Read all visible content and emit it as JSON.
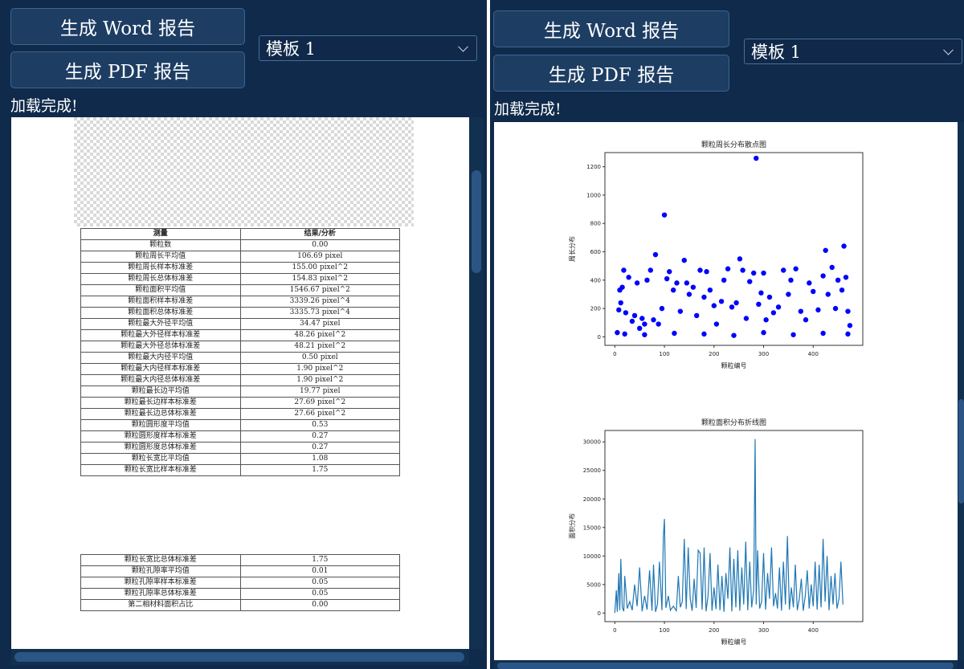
{
  "left": {
    "word_button": "生成 Word 报告",
    "pdf_button": "生成 PDF 报告",
    "template_select": "模板 1",
    "status": "加载完成!",
    "table": {
      "headers": [
        "测量",
        "结果/分析"
      ],
      "rows": [
        [
          "颗粒数",
          "0.00"
        ],
        [
          "颗粒周长平均值",
          "106.69 pixel"
        ],
        [
          "颗粒周长样本标准差",
          "155.00 pixel^2"
        ],
        [
          "颗粒周长总体标准差",
          "154.83 pixel^2"
        ],
        [
          "颗粒面积平均值",
          "1546.67 pixel^2"
        ],
        [
          "颗粒面积样本标准差",
          "3339.26 pixel^4"
        ],
        [
          "颗粒面积总体标准差",
          "3335.73 pixel^4"
        ],
        [
          "颗粒最大外径平均值",
          "34.47 pixel"
        ],
        [
          "颗粒最大外径样本标准差",
          "48.26 pixel^2"
        ],
        [
          "颗粒最大外径总体标准差",
          "48.21 pixel^2"
        ],
        [
          "颗粒最大内径平均值",
          "0.50 pixel"
        ],
        [
          "颗粒最大内径样本标准差",
          "1.90 pixel^2"
        ],
        [
          "颗粒最大内径总体标准差",
          "1.90 pixel^2"
        ],
        [
          "颗粒最长边平均值",
          "19.77 pixel"
        ],
        [
          "颗粒最长边样本标准差",
          "27.69 pixel^2"
        ],
        [
          "颗粒最长边总体标准差",
          "27.66 pixel^2"
        ],
        [
          "颗粒圆形度平均值",
          "0.53"
        ],
        [
          "颗粒圆形度样本标准差",
          "0.27"
        ],
        [
          "颗粒圆形度总体标准差",
          "0.27"
        ],
        [
          "颗粒长宽比平均值",
          "1.08"
        ],
        [
          "颗粒长宽比样本标准差",
          "1.75"
        ]
      ],
      "rows_page2": [
        [
          "颗粒长宽比总体标准差",
          "1.75"
        ],
        [
          "颗粒孔隙率平均值",
          "0.01"
        ],
        [
          "颗粒孔隙率样本标准差",
          "0.05"
        ],
        [
          "颗粒孔隙率总体标准差",
          "0.05"
        ],
        [
          "第二相材料面积占比",
          "0.00"
        ]
      ]
    }
  },
  "right": {
    "word_button": "生成 Word 报告",
    "pdf_button": "生成 PDF 报告",
    "template_select": "模板 1",
    "status": "加载完成!"
  },
  "chart_data": [
    {
      "type": "scatter",
      "title": "颗粒周长分布散点图",
      "xlabel": "颗粒编号",
      "ylabel": "周长分布",
      "xlim": [
        -20,
        500
      ],
      "ylim": [
        -60,
        1300
      ],
      "xticks": [
        "0",
        "100",
        "200",
        "300",
        "400"
      ],
      "yticks": [
        "0",
        "200",
        "400",
        "600",
        "800",
        "1000",
        "1200"
      ],
      "color": "#0000ff",
      "points": [
        [
          5,
          30
        ],
        [
          8,
          190
        ],
        [
          10,
          330
        ],
        [
          12,
          240
        ],
        [
          15,
          350
        ],
        [
          18,
          470
        ],
        [
          22,
          170
        ],
        [
          28,
          420
        ],
        [
          35,
          110
        ],
        [
          40,
          150
        ],
        [
          45,
          380
        ],
        [
          50,
          60
        ],
        [
          55,
          130
        ],
        [
          60,
          90
        ],
        [
          65,
          400
        ],
        [
          72,
          470
        ],
        [
          78,
          120
        ],
        [
          82,
          580
        ],
        [
          88,
          90
        ],
        [
          95,
          200
        ],
        [
          100,
          860
        ],
        [
          105,
          410
        ],
        [
          110,
          460
        ],
        [
          118,
          330
        ],
        [
          125,
          380
        ],
        [
          132,
          180
        ],
        [
          140,
          540
        ],
        [
          145,
          380
        ],
        [
          150,
          300
        ],
        [
          158,
          350
        ],
        [
          165,
          150
        ],
        [
          172,
          470
        ],
        [
          180,
          280
        ],
        [
          185,
          460
        ],
        [
          192,
          330
        ],
        [
          200,
          220
        ],
        [
          205,
          90
        ],
        [
          215,
          250
        ],
        [
          220,
          400
        ],
        [
          228,
          480
        ],
        [
          236,
          210
        ],
        [
          245,
          240
        ],
        [
          252,
          550
        ],
        [
          258,
          470
        ],
        [
          265,
          130
        ],
        [
          272,
          390
        ],
        [
          280,
          450
        ],
        [
          285,
          1260
        ],
        [
          290,
          230
        ],
        [
          295,
          310
        ],
        [
          300,
          450
        ],
        [
          305,
          120
        ],
        [
          312,
          280
        ],
        [
          320,
          170
        ],
        [
          330,
          210
        ],
        [
          340,
          470
        ],
        [
          350,
          300
        ],
        [
          355,
          400
        ],
        [
          365,
          480
        ],
        [
          375,
          180
        ],
        [
          385,
          120
        ],
        [
          392,
          380
        ],
        [
          400,
          320
        ],
        [
          410,
          190
        ],
        [
          420,
          430
        ],
        [
          425,
          610
        ],
        [
          430,
          300
        ],
        [
          438,
          490
        ],
        [
          445,
          200
        ],
        [
          450,
          400
        ],
        [
          458,
          330
        ],
        [
          462,
          640
        ],
        [
          466,
          420
        ],
        [
          470,
          180
        ],
        [
          474,
          80
        ],
        [
          20,
          20
        ],
        [
          60,
          15
        ],
        [
          120,
          25
        ],
        [
          180,
          20
        ],
        [
          240,
          10
        ],
        [
          300,
          30
        ],
        [
          360,
          15
        ],
        [
          420,
          25
        ],
        [
          470,
          20
        ]
      ]
    },
    {
      "type": "line",
      "title": "颗粒面积分布折线图",
      "xlabel": "颗粒编号",
      "ylabel": "面积分布",
      "xlim": [
        -20,
        500
      ],
      "ylim": [
        -1500,
        32000
      ],
      "xticks": [
        "0",
        "100",
        "200",
        "300",
        "400"
      ],
      "yticks": [
        "0",
        "5000",
        "10000",
        "15000",
        "20000",
        "25000",
        "30000"
      ],
      "color": "#1f77b4",
      "x": [
        0,
        3,
        5,
        8,
        10,
        12,
        15,
        18,
        20,
        25,
        30,
        35,
        40,
        45,
        50,
        55,
        60,
        65,
        70,
        75,
        78,
        82,
        86,
        90,
        95,
        98,
        100,
        103,
        108,
        112,
        118,
        124,
        128,
        132,
        136,
        140,
        144,
        148,
        152,
        156,
        160,
        164,
        168,
        172,
        176,
        180,
        184,
        188,
        192,
        196,
        200,
        204,
        208,
        212,
        216,
        220,
        224,
        228,
        232,
        236,
        240,
        244,
        248,
        252,
        256,
        260,
        264,
        268,
        272,
        276,
        280,
        283,
        285,
        288,
        292,
        296,
        300,
        304,
        308,
        312,
        316,
        320,
        324,
        328,
        332,
        336,
        340,
        344,
        348,
        352,
        356,
        360,
        364,
        368,
        372,
        376,
        380,
        384,
        388,
        392,
        396,
        400,
        404,
        408,
        412,
        416,
        420,
        424,
        428,
        432,
        436,
        440,
        444,
        448,
        452,
        456,
        460,
        464,
        468,
        472,
        476
      ],
      "y": [
        0,
        4000,
        200,
        7000,
        500,
        9500,
        1000,
        300,
        6500,
        800,
        2000,
        500,
        5000,
        1200,
        8000,
        300,
        3000,
        600,
        7500,
        400,
        8500,
        200,
        1500,
        9000,
        500,
        13500,
        16500,
        900,
        3000,
        500,
        1200,
        400,
        6500,
        1000,
        2000,
        13000,
        700,
        11500,
        2500,
        400,
        6000,
        900,
        11000,
        10500,
        600,
        11500,
        300,
        3000,
        10500,
        400,
        4500,
        700,
        8500,
        500,
        6500,
        200,
        7000,
        2500,
        11500,
        300,
        9500,
        1000,
        11000,
        400,
        8000,
        1500,
        12500,
        500,
        9000,
        1000,
        4000,
        30500,
        1500,
        11000,
        800,
        2000,
        10500,
        600,
        7000,
        2500,
        11500,
        1200,
        3500,
        800,
        8000,
        400,
        9000,
        1500,
        13500,
        600,
        4500,
        1000,
        8500,
        500,
        2500,
        6000,
        400,
        3000,
        7500,
        800,
        5000,
        1200,
        9000,
        600,
        8500,
        1000,
        13000,
        2000,
        10000,
        500,
        6500,
        1500,
        7000,
        800,
        2500,
        9000,
        1500
      ]
    }
  ]
}
